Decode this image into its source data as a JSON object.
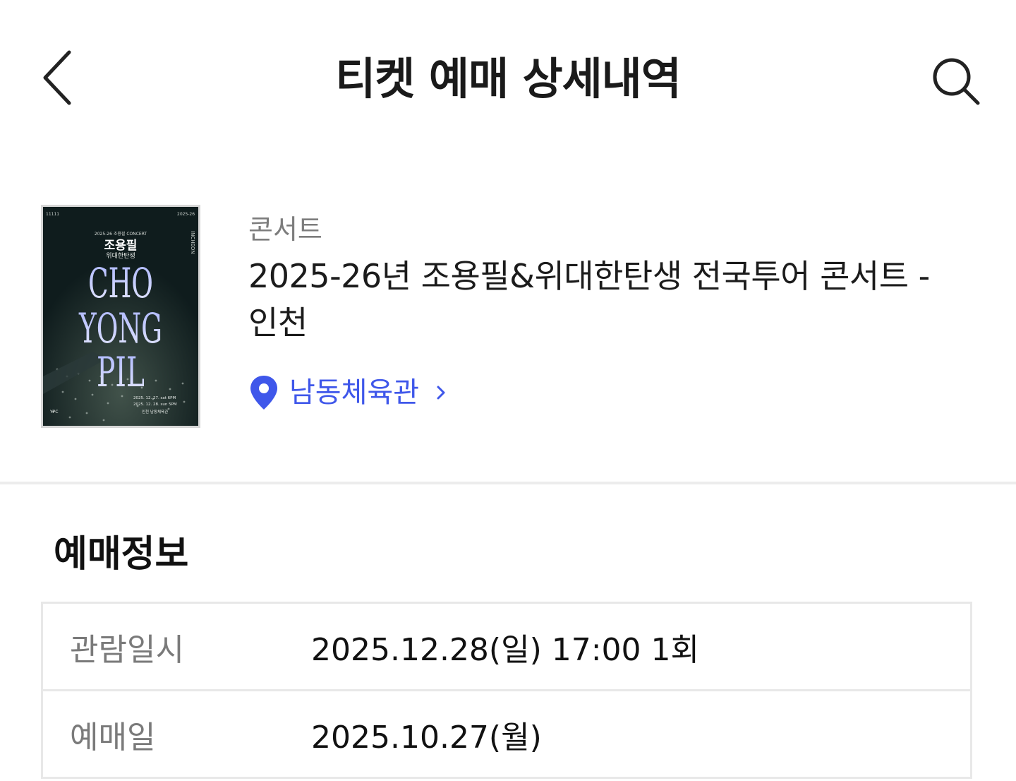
{
  "header": {
    "title": "티켓 예매 상세내역",
    "back_icon": "chevron-left-icon",
    "search_icon": "search-icon"
  },
  "event": {
    "category": "콘서트",
    "title": "2025-26년 조용필&위대한탄생 전국투어 콘서트 - 인천",
    "venue": "남동체육관",
    "venue_color": "#3f57ea",
    "poster": {
      "top_left": "11111",
      "top_right": "2025-26",
      "tour_line": "2025-26 조용필 CONCERT",
      "artist_ko": "조용필",
      "band_ko": "위대한탄생",
      "name_line1": "CHO",
      "name_line2": "YONG",
      "name_line3": "PIL",
      "side_text": "INCHEON",
      "date1": "2025. 12. 27. sat 6PM",
      "date2": "2025. 12. 28. sun 5PM",
      "place": "인천 남동체육관",
      "producer": "YPC"
    }
  },
  "booking": {
    "section_title": "예매정보",
    "rows": [
      {
        "label": "관람일시",
        "value": "2025.12.28(일) 17:00 1회"
      },
      {
        "label": "예매일",
        "value": "2025.10.27(월)"
      }
    ]
  }
}
